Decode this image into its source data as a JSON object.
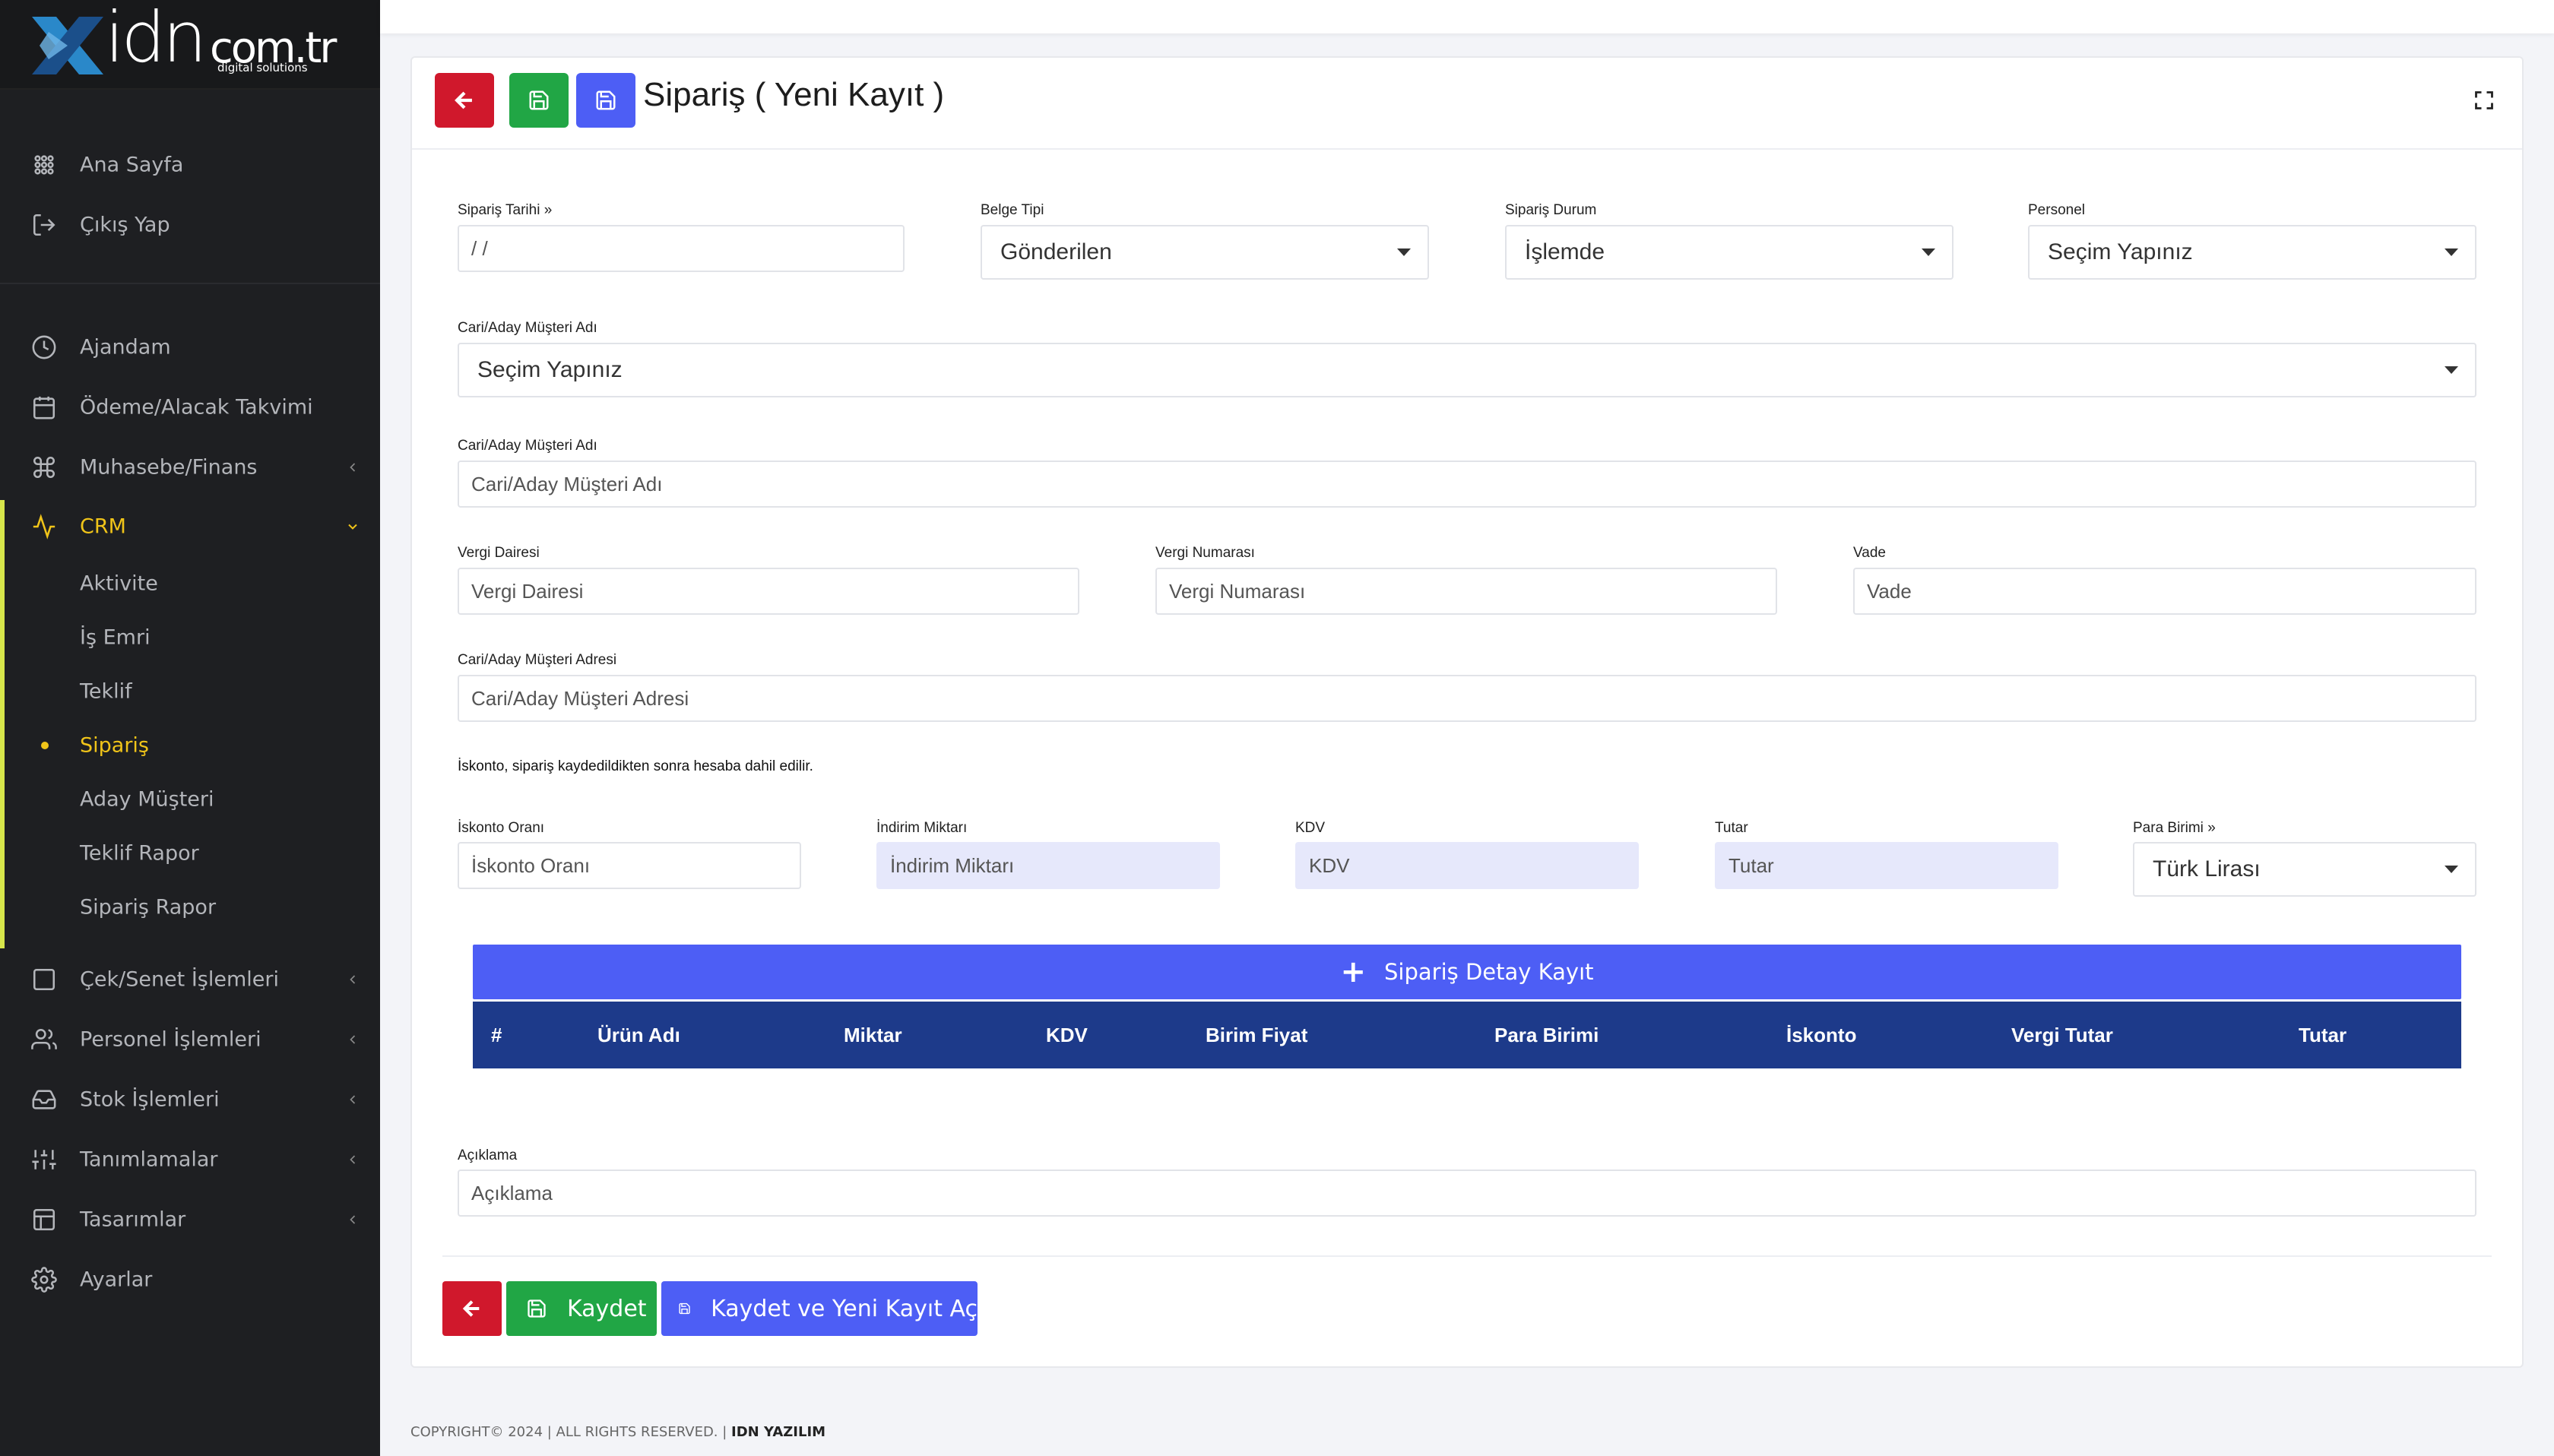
{
  "sidebar": {
    "logo": {
      "brand": "idn",
      "domain": "com.tr",
      "tagline": "digital solutions"
    },
    "items": [
      {
        "label": "Ana Sayfa",
        "icon": "dashboard-icon"
      },
      {
        "label": "Çıkış Yap",
        "icon": "logout-icon"
      },
      {
        "label": "Ajandam",
        "icon": "clock-icon"
      },
      {
        "label": "Ödeme/Alacak Takvimi",
        "icon": "calendar-icon"
      },
      {
        "label": "Muhasebe/Finans",
        "icon": "command-icon"
      },
      {
        "label": "CRM",
        "icon": "activity-icon"
      },
      {
        "label": "Çek/Senet İşlemleri",
        "icon": "square-icon"
      },
      {
        "label": "Personel İşlemleri",
        "icon": "users-icon"
      },
      {
        "label": "Stok İşlemleri",
        "icon": "inbox-icon"
      },
      {
        "label": "Tanımlamalar",
        "icon": "sliders-icon"
      },
      {
        "label": "Tasarımlar",
        "icon": "layout-icon"
      },
      {
        "label": "Ayarlar",
        "icon": "settings-icon"
      }
    ],
    "crm_sub": [
      {
        "label": "Aktivite"
      },
      {
        "label": "İş Emri"
      },
      {
        "label": "Teklif"
      },
      {
        "label": "Sipariş"
      },
      {
        "label": "Aday Müşteri"
      },
      {
        "label": "Teklif Rapor"
      },
      {
        "label": "Sipariş Rapor"
      }
    ],
    "active_color": "#f0c419"
  },
  "header": {
    "title": "Sipariş ( Yeni Kayıt )"
  },
  "form": {
    "siparis_tarihi": {
      "label": "Sipariş Tarihi",
      "value": "/ /"
    },
    "belge_tipi": {
      "label": "Belge Tipi",
      "value": "Gönderilen"
    },
    "siparis_durum": {
      "label": "Sipariş Durum",
      "value": "İşlemde"
    },
    "personel": {
      "label": "Personel",
      "value": "Seçim Yapınız"
    },
    "cari_select": {
      "label": "Cari/Aday Müşteri Adı",
      "value": "Seçim Yapınız"
    },
    "cari_adi": {
      "label": "Cari/Aday Müşteri Adı",
      "placeholder": "Cari/Aday Müşteri Adı"
    },
    "vergi_dairesi": {
      "label": "Vergi Dairesi",
      "placeholder": "Vergi Dairesi"
    },
    "vergi_numarasi": {
      "label": "Vergi Numarası",
      "placeholder": "Vergi Numarası"
    },
    "vade": {
      "label": "Vade",
      "placeholder": "Vade"
    },
    "cari_adresi": {
      "label": "Cari/Aday Müşteri Adresi",
      "placeholder": "Cari/Aday Müşteri Adresi"
    },
    "note": "İskonto, sipariş kaydedildikten sonra hesaba dahil edilir.",
    "iskonto_orani": {
      "label": "İskonto Oranı",
      "placeholder": "İskonto Oranı"
    },
    "indirim_miktari": {
      "label": "İndirim Miktarı",
      "placeholder": "İndirim Miktarı"
    },
    "kdv": {
      "label": "KDV",
      "placeholder": "KDV"
    },
    "tutar": {
      "label": "Tutar",
      "placeholder": "Tutar"
    },
    "para_birimi": {
      "label": "Para Birimi",
      "value": "Türk Lirası"
    },
    "aciklama": {
      "label": "Açıklama",
      "placeholder": "Açıklama"
    }
  },
  "detail": {
    "button_label": "Sipariş Detay Kayıt",
    "columns": [
      "#",
      "Ürün Adı",
      "Miktar",
      "KDV",
      "Birim Fiyat",
      "Para Birimi",
      "İskonto",
      "Vergi Tutar",
      "Tutar"
    ]
  },
  "footer_buttons": {
    "save": "Kaydet",
    "save_new": "Kaydet ve Yeni Kayıt Aç"
  },
  "copyright": {
    "text": "COPYRIGHT© 2024 | ALL RIGHTS RESERVED. |",
    "company": "IDN YAZILIM"
  },
  "colors": {
    "red": "#d0182c",
    "green": "#21a645",
    "blue": "#4d5ef5",
    "table_header": "#1d3a8a"
  }
}
